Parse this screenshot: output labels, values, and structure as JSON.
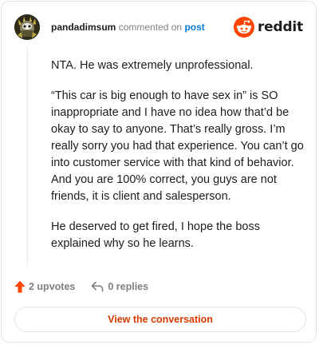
{
  "comment": {
    "username": "pandadimsum",
    "action": "commented on",
    "post_link": "post",
    "paragraphs": [
      "NTA. He was extremely unprofessional.",
      "“This car is big enough to have sex in” is SO inappropriate and I have no idea how that’d be okay to say to anyone. That’s really gross. I’m really sorry you had that experience. You can’t go into customer service with that kind of behavior. And you are 100% correct, you guys are not friends, it is client and salesperson.",
      "He deserved to get fired, I hope the boss explained why so he learns."
    ]
  },
  "brand": {
    "wordmark": "reddit",
    "logo_icon": "reddit-snoo-icon",
    "accent_color": "#ff4500"
  },
  "footer": {
    "upvotes_label": "2 upvotes",
    "replies_label": "0 replies",
    "upvote_icon": "upvote-arrow-icon",
    "reply_icon": "reply-arrow-icon",
    "upvote_color": "#ff4500"
  },
  "cta": {
    "label": "View the conversation",
    "color": "#d93a00"
  },
  "avatar": {
    "icon": "user-avatar"
  }
}
